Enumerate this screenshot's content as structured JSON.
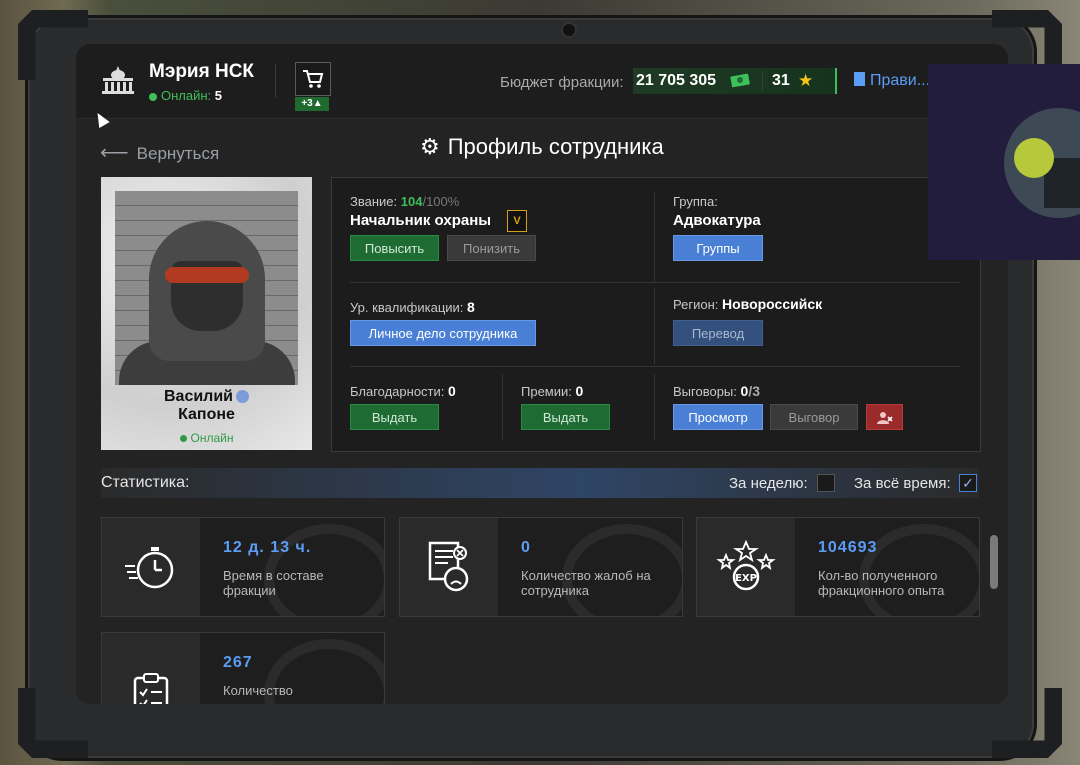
{
  "header": {
    "org_name": "Мэрия НСК",
    "online_label": "Онлайн:",
    "online_count": "5",
    "cart_badge": "+3",
    "budget_label": "Бюджет фракции:",
    "budget_value": "21 705 305",
    "stars_value": "31",
    "rules_label": "Прави..."
  },
  "nav": {
    "back_label": "Вернуться",
    "page_title": "Профиль сотрудника"
  },
  "employee": {
    "name_line1": "Василий",
    "name_line2": "Капоне",
    "status": "Онлайн"
  },
  "info": {
    "rank_label": "Звание:",
    "rank_points": "104",
    "rank_max": "/100%",
    "rank_name": "Начальник охраны",
    "rank_icon_text": "V",
    "promote_btn": "Повысить",
    "demote_btn": "Понизить",
    "group_label": "Группа:",
    "group_name": "Адвокатура",
    "groups_btn": "Группы",
    "qual_label": "Ур. квалификации:",
    "qual_value": "8",
    "personal_file_btn": "Личное дело сотрудника",
    "region_label": "Регион:",
    "region_value": "Новороссийск",
    "transfer_btn": "Перевод",
    "thanks_label": "Благодарности:",
    "thanks_value": "0",
    "thanks_btn": "Выдать",
    "bonus_label": "Премии:",
    "bonus_value": "0",
    "bonus_btn": "Выдать",
    "warn_label": "Выговоры:",
    "warn_value": "0",
    "warn_max": "/3",
    "view_btn": "Просмотр",
    "warn_btn": "Выговор"
  },
  "stats": {
    "title": "Статистика:",
    "week_label": "За неделю:",
    "all_label": "За всё время:",
    "cards": [
      {
        "value": "12 д. 13 ч.",
        "desc": "Время в составе фракции",
        "icon": "stopwatch-icon"
      },
      {
        "value": "0",
        "desc": "Количество жалоб на сотрудника",
        "icon": "complaint-icon"
      },
      {
        "value": "104693",
        "desc": "Кол-во полученного фракционного опыта",
        "icon": "exp-icon"
      },
      {
        "value": "267",
        "desc": "Количество",
        "icon": "checklist-icon"
      }
    ]
  },
  "colors": {
    "accent_blue": "#5b9cf5",
    "online_green": "#3fbf5a",
    "star_gold": "#f5c518"
  }
}
